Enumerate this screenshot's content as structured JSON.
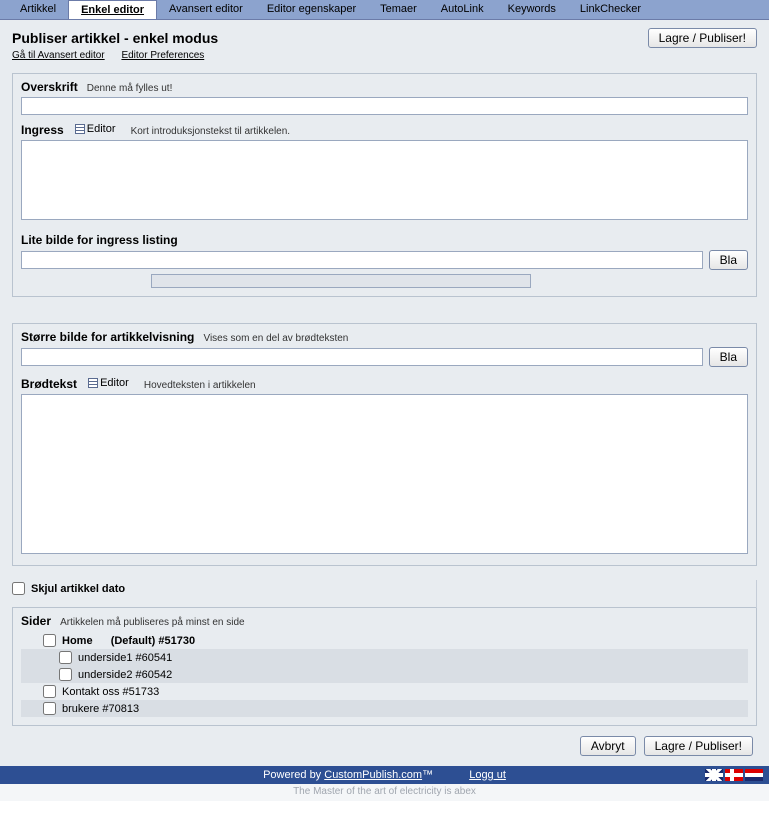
{
  "tabs": [
    "Artikkel",
    "Enkel editor",
    "Avansert editor",
    "Editor egenskaper",
    "Temaer",
    "AutoLink",
    "Keywords",
    "LinkChecker"
  ],
  "active_tab": "Enkel editor",
  "header": {
    "title": "Publiser artikkel - enkel modus",
    "link_advanced": "Gå til Avansert editor",
    "link_prefs": "Editor Preferences",
    "save_btn": "Lagre / Publiser!"
  },
  "fields": {
    "overskrift_label": "Overskrift",
    "overskrift_hint": "Denne må fylles ut!",
    "ingress_label": "Ingress",
    "editor_switch": "Editor",
    "ingress_hint": "Kort introduksjonstekst til artikkelen.",
    "small_image_label": "Lite bilde for ingress listing",
    "browse_btn": "Bla",
    "big_image_label": "Større bilde for artikkelvisning",
    "big_image_hint": "Vises som en del av brødteksten",
    "body_label": "Brødtekst",
    "body_hint": "Hovedteksten i artikkelen",
    "hide_date_label": "Skjul artikkel dato"
  },
  "pages": {
    "label": "Sider",
    "hint": "Artikkelen må publiseres på minst en side",
    "items": [
      {
        "label": "Home",
        "suffix": "(Default) #51730",
        "indent": 1,
        "bold": true,
        "shade": false
      },
      {
        "label": "underside1 #60541",
        "suffix": "",
        "indent": 2,
        "bold": false,
        "shade": true
      },
      {
        "label": "underside2 #60542",
        "suffix": "",
        "indent": 2,
        "bold": false,
        "shade": true
      },
      {
        "label": "Kontakt oss #51733",
        "suffix": "",
        "indent": 1,
        "bold": false,
        "shade": false
      },
      {
        "label": "brukere #70813",
        "suffix": "",
        "indent": 1,
        "bold": false,
        "shade": true
      }
    ]
  },
  "actions": {
    "cancel": "Avbryt",
    "save": "Lagre / Publiser!"
  },
  "footer": {
    "powered_prefix": "Powered by ",
    "powered_link": "CustomPublish.com",
    "powered_suffix": "™",
    "logout": "Logg ut",
    "tagline": "The Master of the art of electricity is abex"
  }
}
